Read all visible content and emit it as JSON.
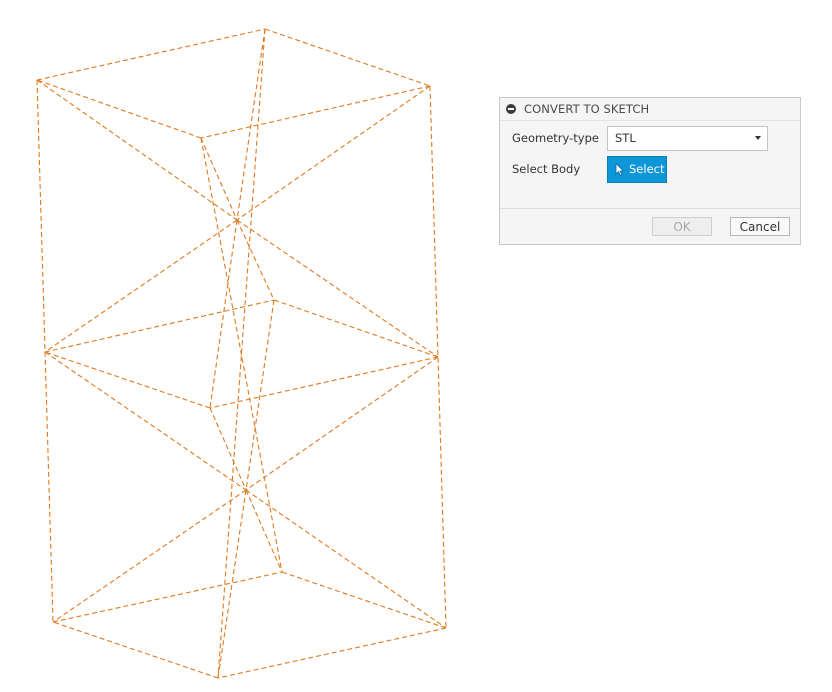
{
  "viewport": {
    "wireframe_color": "#e07a20"
  },
  "dialog": {
    "title": "CONVERT TO SKETCH",
    "collapse_icon": "minus-circle-icon",
    "geometry_type": {
      "label": "Geometry-type",
      "selected": "STL"
    },
    "select_body": {
      "label": "Select Body",
      "button_label": "Select",
      "button_color": "#0d96d8"
    },
    "ok_label": "OK",
    "cancel_label": "Cancel"
  }
}
